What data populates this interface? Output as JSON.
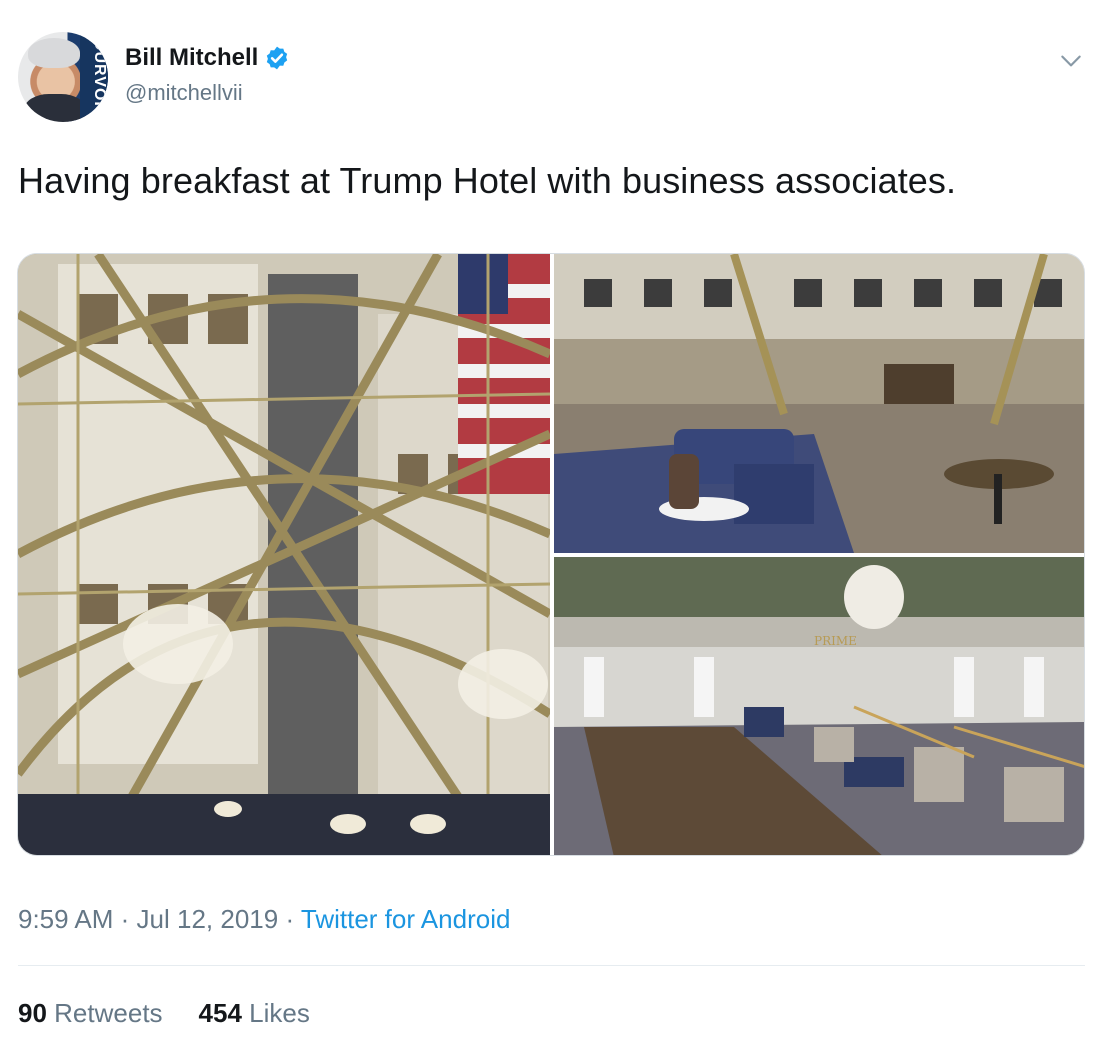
{
  "user": {
    "display_name": "Bill Mitchell",
    "handle": "@mitchellvii",
    "avatar_text": "OURVOICE",
    "verified": true
  },
  "tweet": {
    "text": "Having breakfast at Trump Hotel with business associates."
  },
  "media": {
    "photos": [
      {
        "icon": "atrium-photo"
      },
      {
        "icon": "lobby-lounge-photo"
      },
      {
        "icon": "lobby-prime-photo",
        "sign_text": "PRIME"
      }
    ]
  },
  "meta": {
    "time": "9:59 AM",
    "separator": "·",
    "date": "Jul 12, 2019",
    "source": "Twitter for Android"
  },
  "stats": {
    "retweets_count": "90",
    "retweets_label": "Retweets",
    "likes_count": "454",
    "likes_label": "Likes"
  },
  "colors": {
    "link": "#1b95e0",
    "secondary_text": "#657786",
    "verified": "#1da1f2"
  }
}
